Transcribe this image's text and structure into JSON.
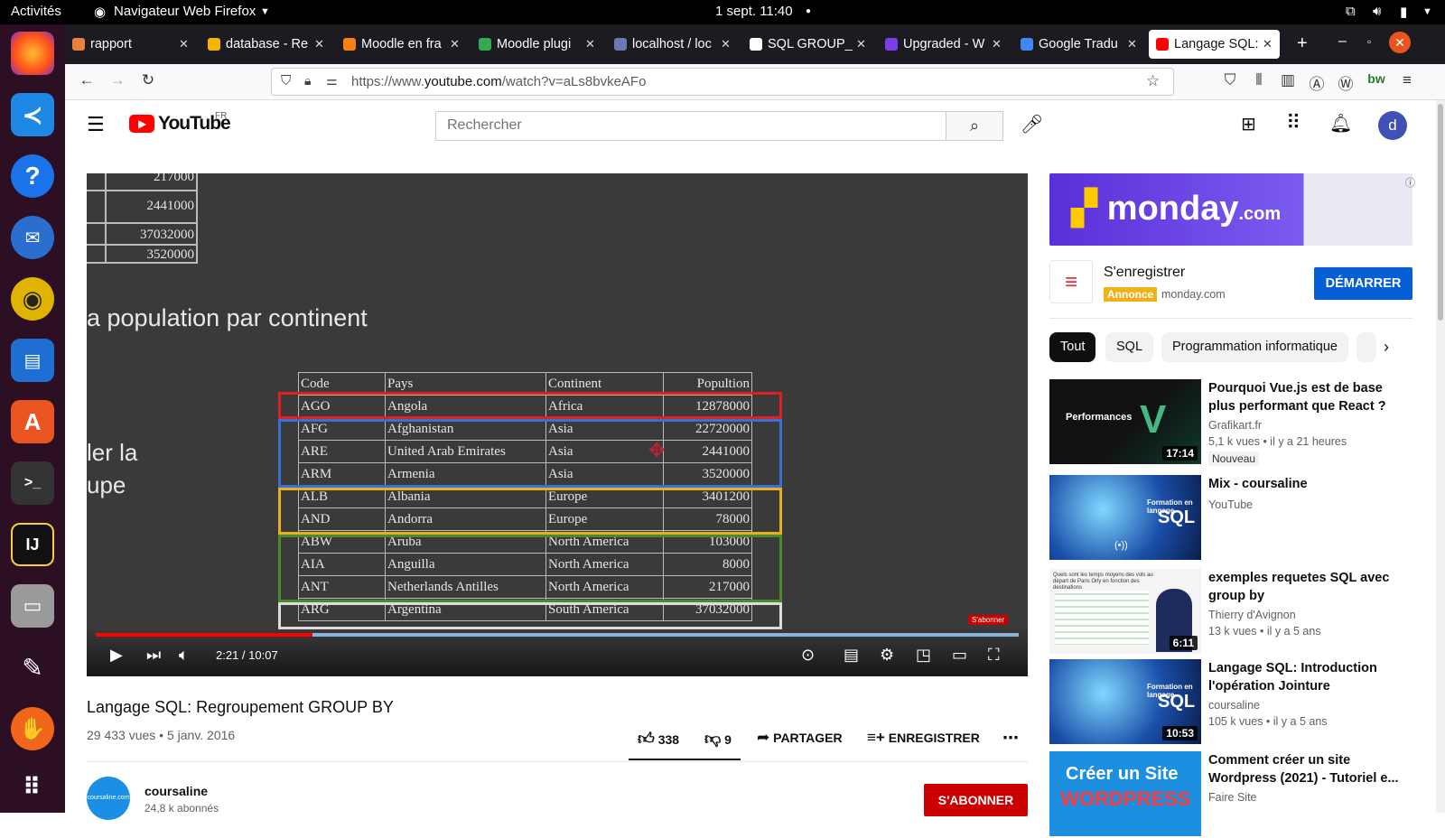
{
  "system": {
    "activities": "Activités",
    "app_menu": "Navigateur Web Firefox",
    "datetime": "1 sept.  11:40"
  },
  "tabs": [
    {
      "label": "rapport",
      "color": "#e8823a"
    },
    {
      "label": "database - Re",
      "color": "#f4b400"
    },
    {
      "label": "Moodle en fra",
      "color": "#f98012"
    },
    {
      "label": "Moodle plugi",
      "color": "#34a853"
    },
    {
      "label": "localhost / loc",
      "color": "#6c78af"
    },
    {
      "label": "SQL GROUP_C",
      "color": "#ffffff"
    },
    {
      "label": "Upgraded - W",
      "color": "#7b3fe4"
    },
    {
      "label": "Google Tradu",
      "color": "#4285f4"
    },
    {
      "label": "Langage SQL:",
      "color": "#ff0000"
    }
  ],
  "url": {
    "prefix": "https://www.",
    "domain": "youtube.com",
    "path": "/watch?v=aLs8bvkeAFo"
  },
  "youtube": {
    "logo": "YouTube",
    "region": "FR",
    "search_placeholder": "Rechercher",
    "avatar_letter": "d"
  },
  "video": {
    "slide_numbers": [
      "217000",
      "2441000",
      "37032000",
      "3520000"
    ],
    "slide_heading": "a population par continent",
    "slide_side_1": "ler la",
    "slide_side_2": "upe",
    "table_headers": [
      "Code",
      "Pays",
      "Continent",
      "Popultion"
    ],
    "table_rows": [
      [
        "AGO",
        "Angola",
        "Africa",
        "12878000"
      ],
      [
        "AFG",
        "Afghanistan",
        "Asia",
        "22720000"
      ],
      [
        "ARE",
        "United Arab Emirates",
        "Asia",
        "2441000"
      ],
      [
        "ARM",
        "Armenia",
        "Asia",
        "3520000"
      ],
      [
        "ALB",
        "Albania",
        "Europe",
        "3401200"
      ],
      [
        "AND",
        "Andorra",
        "Europe",
        "78000"
      ],
      [
        "ABW",
        "Aruba",
        "North America",
        "103000"
      ],
      [
        "AIA",
        "Anguilla",
        "North America",
        "8000"
      ],
      [
        "ANT",
        "Netherlands Antilles",
        "North America",
        "217000"
      ],
      [
        "ARG",
        "Argentina",
        "South America",
        "37032000"
      ]
    ],
    "subscribe_watermark": "S'abonner",
    "time": "2:21 / 10:07",
    "progress": 0.235,
    "title": "Langage SQL: Regroupement GROUP BY",
    "meta": "29 433 vues • 5 janv. 2016",
    "likes": "338",
    "dislikes": "9",
    "share": "PARTAGER",
    "save": "ENREGISTRER"
  },
  "channel": {
    "name": "coursaline",
    "subs": "24,8 k abonnés",
    "subscribe": "S'ABONNER",
    "avatar_text": "coursaline.com"
  },
  "ad": {
    "brand": "monday",
    "brand_suffix": ".com",
    "title": "S'enregistrer",
    "badge": "Annonce",
    "domain": "monday.com",
    "cta": "DÉMARRER"
  },
  "chips": [
    "Tout",
    "SQL",
    "Programmation informatique"
  ],
  "recommendations": [
    {
      "title": "Pourquoi Vue.js est de base plus performant que React ?",
      "channel": "Grafikart.fr",
      "meta": "5,1 k vues • il y a 21 heures",
      "badge": "Nouveau",
      "duration": "17:14",
      "thumb_text": "Performances"
    },
    {
      "title": "Mix - coursaline",
      "channel": "YouTube",
      "meta": "",
      "badge": "",
      "duration": "",
      "thumb_text": "SQL",
      "thumb_sub": "Formation en langage"
    },
    {
      "title": "exemples requetes SQL avec group by",
      "channel": "Thierry d'Avignon",
      "meta": "13 k vues • il y a 5 ans",
      "badge": "",
      "duration": "6:11",
      "thumb_text": "Quels sont les temps moyens des vols au départ de Paris Orly en fonction des destinations"
    },
    {
      "title": "Langage SQL: Introduction l'opération Jointure",
      "channel": "coursaline",
      "meta": "105 k vues • il y a 5 ans",
      "badge": "",
      "duration": "10:53",
      "thumb_text": "SQL",
      "thumb_sub": "Formation en langage"
    },
    {
      "title": "Comment créer un site Wordpress (2021) - Tutoriel e...",
      "channel": "Faire Site",
      "meta": "",
      "badge": "",
      "duration": "",
      "thumb_text": "Créer un Site",
      "thumb_sub": "WORDPRESS"
    }
  ]
}
